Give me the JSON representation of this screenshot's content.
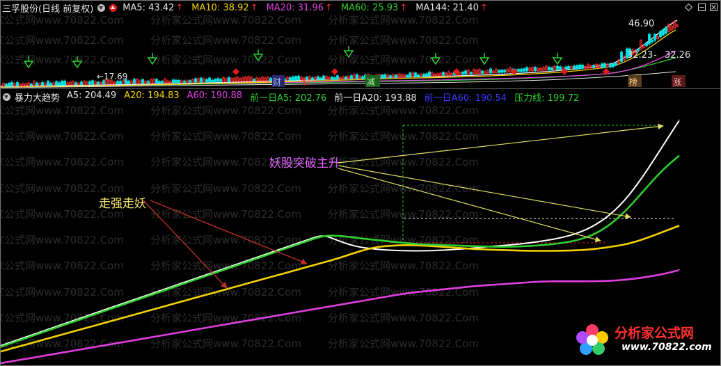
{
  "top_panel": {
    "title": "三孚股份(日线 前复权)",
    "ma": [
      {
        "label": "MA5: 43.42",
        "color": "#e8e8e8"
      },
      {
        "label": "MA10: 38.92",
        "color": "#f5d300"
      },
      {
        "label": "MA20: 31.96",
        "color": "#e040e0"
      },
      {
        "label": "MA60: 25.93",
        "color": "#2ed02e"
      },
      {
        "label": "MA144: 21.40",
        "color": "#e8e8e8"
      }
    ],
    "arrow_glyph": "↑",
    "price_high": "46.90",
    "price_mid": "32.23",
    "price_mid2": "32.26",
    "price_low": "17.69",
    "markers": [
      "财",
      "$",
      "减",
      "榜",
      "涨"
    ]
  },
  "bottom_panel": {
    "title": "暴力大趋势",
    "indicators": [
      {
        "label": "A5: 204.49",
        "color": "#e8e8e8"
      },
      {
        "label": "A20: 194.83",
        "color": "#f5d300"
      },
      {
        "label": "A60: 190.88",
        "color": "#e040e0"
      },
      {
        "label": "前一日A5: 202.76",
        "color": "#2ed02e"
      },
      {
        "label": "前一日A20: 193.88",
        "color": "#e8e8e8"
      },
      {
        "label": "前一日A60: 190.54",
        "color": "#3a3aff"
      },
      {
        "label": "压力线: 199.72",
        "color": "#2ed02e"
      }
    ],
    "annotation_1": "走强走妖",
    "annotation_2": "妖股突破主升"
  },
  "watermark": {
    "text": "分析家公式网www.70822.Com",
    "logo_name": "分析家公式网",
    "logo_url": "www.70822.com"
  },
  "chart_data": {
    "type": "line",
    "x": [
      0,
      1,
      2,
      3,
      4,
      5,
      6,
      7,
      8,
      9,
      10,
      11,
      12,
      13,
      14,
      15,
      16,
      17,
      18,
      19,
      20,
      21,
      22,
      23,
      24,
      25,
      26,
      27,
      28,
      29,
      30,
      31,
      32,
      33,
      34,
      35,
      36,
      37,
      38,
      39,
      40
    ],
    "series": [
      {
        "name": "A5",
        "color": "#ffffff",
        "values": [
          181,
          182,
          183,
          184,
          185,
          186,
          187,
          188,
          189,
          190,
          191,
          192,
          193,
          194,
          195,
          196,
          197,
          198,
          199,
          200,
          198.8,
          197.9,
          197.5,
          197.3,
          197.2,
          197.2,
          197.3,
          197.5,
          197.7,
          198,
          198.2,
          198.5,
          198.9,
          199.4,
          200.2,
          201.5,
          203.5,
          206.5,
          210.5,
          215,
          219.5
        ]
      },
      {
        "name": "A20",
        "color": "#f5d300",
        "values": [
          180,
          180.8,
          181.6,
          182.4,
          183.2,
          184,
          184.8,
          185.6,
          186.4,
          187.2,
          188,
          188.8,
          189.6,
          190.4,
          191.2,
          192,
          192.8,
          193.6,
          194.4,
          195.2,
          196,
          197,
          197.8,
          198.1,
          198.2,
          198.1,
          197.9,
          197.7,
          197.5,
          197.4,
          197.3,
          197.2,
          197.2,
          197.2,
          197.3,
          197.5,
          197.9,
          198.4,
          199.3,
          200.4,
          201.5
        ]
      },
      {
        "name": "A60",
        "color": "#e040e0",
        "values": [
          178,
          178.5,
          179,
          179.5,
          180,
          180.5,
          181,
          181.5,
          182,
          182.5,
          183,
          183.5,
          184,
          184.5,
          185,
          185.5,
          186,
          186.5,
          187,
          187.5,
          188,
          188.5,
          189,
          189.5,
          190,
          190.3,
          190.6,
          190.9,
          191.2,
          191.4,
          191.6,
          191.8,
          192,
          192,
          192,
          192,
          192.1,
          192.3,
          192.7,
          193.2,
          193.9
        ]
      },
      {
        "name": "前一日A5",
        "color": "#2ed02e",
        "values": [
          180.8,
          181.8,
          182.8,
          183.8,
          184.8,
          185.8,
          186.8,
          187.8,
          188.8,
          189.8,
          190.8,
          191.8,
          192.8,
          193.8,
          194.8,
          195.8,
          196.8,
          197.8,
          198.8,
          199.8,
          199.8,
          199.4,
          199.1,
          198.8,
          198.5,
          198.3,
          198.2,
          198.1,
          198,
          197.9,
          197.9,
          198,
          198.2,
          198.5,
          199,
          200,
          201.8,
          204.5,
          207.8,
          211,
          213.5
        ]
      }
    ],
    "ylim": [
      178,
      222
    ]
  }
}
